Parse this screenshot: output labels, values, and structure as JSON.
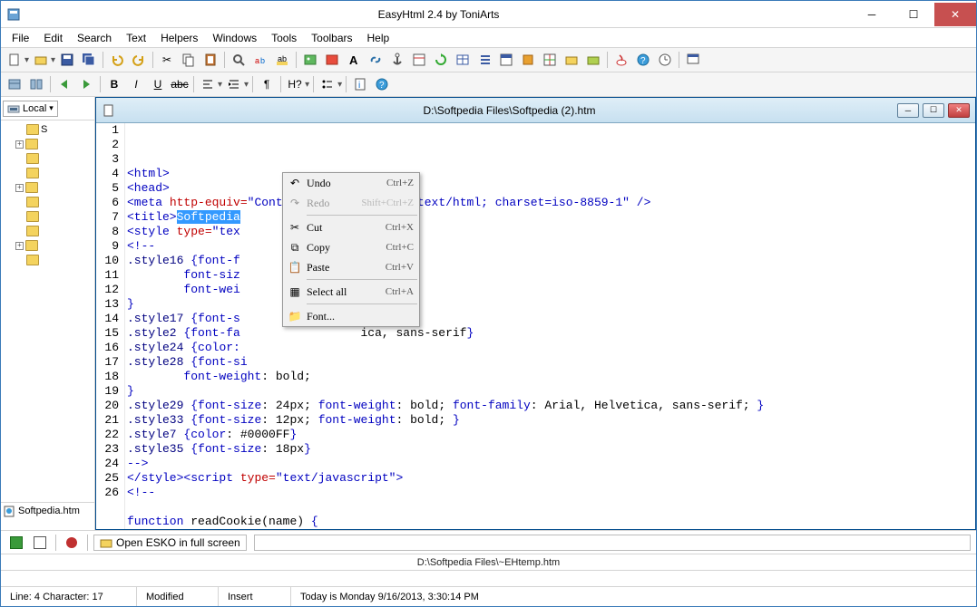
{
  "window": {
    "title": "EasyHtml 2.4 by ToniArts"
  },
  "menu": [
    "File",
    "Edit",
    "Search",
    "Text",
    "Helpers",
    "Windows",
    "Tools",
    "Toolbars",
    "Help"
  ],
  "sidebar": {
    "local_label": "Local",
    "file_item": "Softpedia.htm"
  },
  "document": {
    "title": "D:\\Softpedia Files\\Softpedia (2).htm",
    "selected_text": "Softpedia",
    "lines": [
      {
        "n": 1,
        "html": "<span class='tag'>&lt;html&gt;</span>"
      },
      {
        "n": 2,
        "html": "<span class='tag'>&lt;head&gt;</span>"
      },
      {
        "n": 3,
        "html": "<span class='tag'>&lt;meta</span> <span class='attr'>http-equiv=</span><span class='tag'>\"Content-Type\"</span> <span class='attr'>content=</span><span class='tag'>\"text/html; charset=iso-8859-1\"</span> <span class='tag'>/&gt;</span>"
      },
      {
        "n": 4,
        "html": "<span class='tag'>&lt;title&gt;</span><span class='sel'>Softpedia</span>"
      },
      {
        "n": 5,
        "html": "<span class='tag'>&lt;style</span> <span class='attr'>type=</span><span class='tag'>\"tex</span>"
      },
      {
        "n": 6,
        "html": "<span class='tag'>&lt;!--</span>"
      },
      {
        "n": 7,
        "html": "<span class='css-sel'>.style16</span> <span class='tag'>{</span><span class='css-prop'>font-f</span>"
      },
      {
        "n": 8,
        "html": "        <span class='css-prop'>font-siz</span>"
      },
      {
        "n": 9,
        "html": "        <span class='css-prop'>font-wei</span>"
      },
      {
        "n": 10,
        "html": "<span class='tag'>}</span>"
      },
      {
        "n": 11,
        "html": "<span class='css-sel'>.style17</span> <span class='tag'>{</span><span class='css-prop'>font-s</span>"
      },
      {
        "n": 12,
        "html": "<span class='css-sel'>.style2</span> <span class='tag'>{</span><span class='css-prop'>font-fa</span>                 ica, sans-serif<span class='tag'>}</span>"
      },
      {
        "n": 13,
        "html": "<span class='css-sel'>.style24</span> <span class='tag'>{</span><span class='css-prop'>color:</span>"
      },
      {
        "n": 14,
        "html": "<span class='css-sel'>.style28</span> <span class='tag'>{</span><span class='css-prop'>font-si</span>"
      },
      {
        "n": 15,
        "html": "        <span class='css-prop'>font-weight</span>: bold;"
      },
      {
        "n": 16,
        "html": "<span class='tag'>}</span>"
      },
      {
        "n": 17,
        "html": "<span class='css-sel'>.style29</span> <span class='tag'>{</span><span class='css-prop'>font-size</span>: 24px; <span class='css-prop'>font-weight</span>: bold; <span class='css-prop'>font-family</span>: Arial, Helvetica, sans-serif; <span class='tag'>}</span>"
      },
      {
        "n": 18,
        "html": "<span class='css-sel'>.style33</span> <span class='tag'>{</span><span class='css-prop'>font-size</span>: 12px; <span class='css-prop'>font-weight</span>: bold; <span class='tag'>}</span>"
      },
      {
        "n": 19,
        "html": "<span class='css-sel'>.style7</span> <span class='tag'>{</span><span class='css-prop'>color</span>: #0000FF<span class='tag'>}</span>"
      },
      {
        "n": 20,
        "html": "<span class='css-sel'>.style35</span> <span class='tag'>{</span><span class='css-prop'>font-size</span>: 18px<span class='tag'>}</span>"
      },
      {
        "n": 21,
        "html": "<span class='tag'>--&gt;</span>"
      },
      {
        "n": 22,
        "html": "<span class='tag'>&lt;/style&gt;&lt;script</span> <span class='attr'>type=</span><span class='tag'>\"text/javascript\"&gt;</span>"
      },
      {
        "n": 23,
        "html": "<span class='tag'>&lt;!--</span>"
      },
      {
        "n": 24,
        "html": ""
      },
      {
        "n": 25,
        "html": "<span class='kw'>function</span> readCookie(name) <span class='tag'>{</span>"
      },
      {
        "n": 26,
        "html": ""
      }
    ]
  },
  "context_menu": [
    {
      "icon": "undo",
      "label": "Undo",
      "shortcut": "Ctrl+Z",
      "enabled": true
    },
    {
      "icon": "redo",
      "label": "Redo",
      "shortcut": "Shift+Ctrl+Z",
      "enabled": false
    },
    {
      "sep": true
    },
    {
      "icon": "cut",
      "label": "Cut",
      "shortcut": "Ctrl+X",
      "enabled": true
    },
    {
      "icon": "copy",
      "label": "Copy",
      "shortcut": "Ctrl+C",
      "enabled": true
    },
    {
      "icon": "paste",
      "label": "Paste",
      "shortcut": "Ctrl+V",
      "enabled": true
    },
    {
      "sep": true
    },
    {
      "icon": "selectall",
      "label": "Select all",
      "shortcut": "Ctrl+A",
      "enabled": true
    },
    {
      "sep": true
    },
    {
      "icon": "font",
      "label": "Font...",
      "shortcut": "",
      "enabled": true
    }
  ],
  "bottom_bar": {
    "open_esko": "Open ESKO in full screen"
  },
  "path_bar": "D:\\Softpedia Files\\~EHtemp.htm",
  "status": {
    "pos": "Line: 4 Character: 17",
    "modified": "Modified",
    "mode": "Insert",
    "date": "Today is Monday 9/16/2013, 3:30:14 PM"
  },
  "toolbar2": {
    "h_label": "H?"
  }
}
